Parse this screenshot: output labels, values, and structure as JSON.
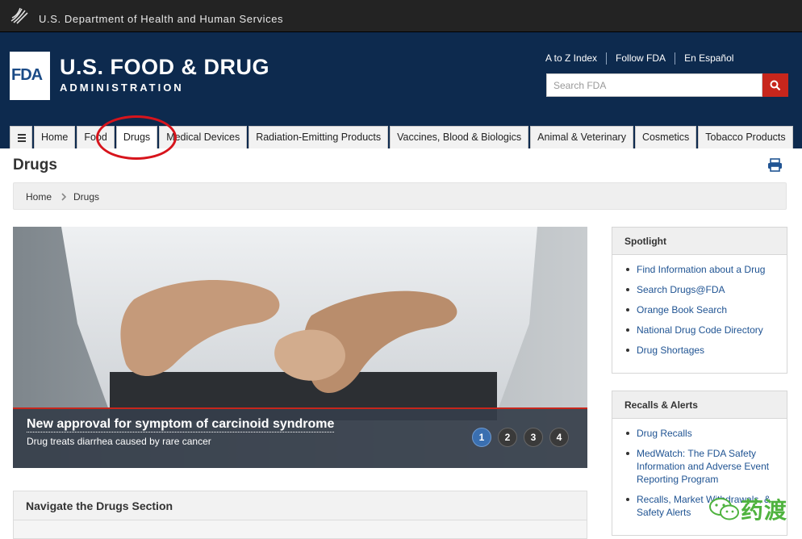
{
  "hhs": {
    "title": "U.S. Department of Health and Human Services"
  },
  "brand": {
    "logo_text": "FDA",
    "title": "U.S. FOOD & DRUG",
    "subtitle": "ADMINISTRATION",
    "header_bg": "#0d2a4e",
    "accent": "#c7261c",
    "link_color": "#205493"
  },
  "utility_links": [
    "A to Z Index",
    "Follow FDA",
    "En Español"
  ],
  "search": {
    "placeholder": "Search FDA",
    "icon": "search-icon"
  },
  "nav": {
    "menu_icon": "hamburger-icon",
    "tabs": [
      "Home",
      "Food",
      "Drugs",
      "Medical Devices",
      "Radiation-Emitting Products",
      "Vaccines, Blood & Biologics",
      "Animal & Veterinary",
      "Cosmetics",
      "Tobacco Products"
    ],
    "active": "Drugs"
  },
  "page": {
    "title": "Drugs",
    "print_icon": "print-icon"
  },
  "breadcrumb": [
    "Home",
    "Drugs"
  ],
  "carousel": {
    "headline": "New approval for symptom of carcinoid syndrome",
    "subheadline": "Drug treats diarrhea caused by rare cancer",
    "pages": [
      "1",
      "2",
      "3",
      "4"
    ],
    "active_page": "1"
  },
  "navigate_section": {
    "title": "Navigate the Drugs Section"
  },
  "spotlight": {
    "title": "Spotlight",
    "items": [
      "Find Information about a Drug",
      "Search Drugs@FDA",
      "Orange Book Search",
      "National Drug Code Directory",
      "Drug Shortages"
    ]
  },
  "recalls": {
    "title": "Recalls & Alerts",
    "items": [
      "Drug Recalls",
      "MedWatch: The FDA Safety Information and Adverse Event Reporting Program",
      "Recalls, Market Withdrawals, & Safety Alerts"
    ]
  },
  "watermark": {
    "text": "药渡",
    "icon": "wechat-icon"
  }
}
